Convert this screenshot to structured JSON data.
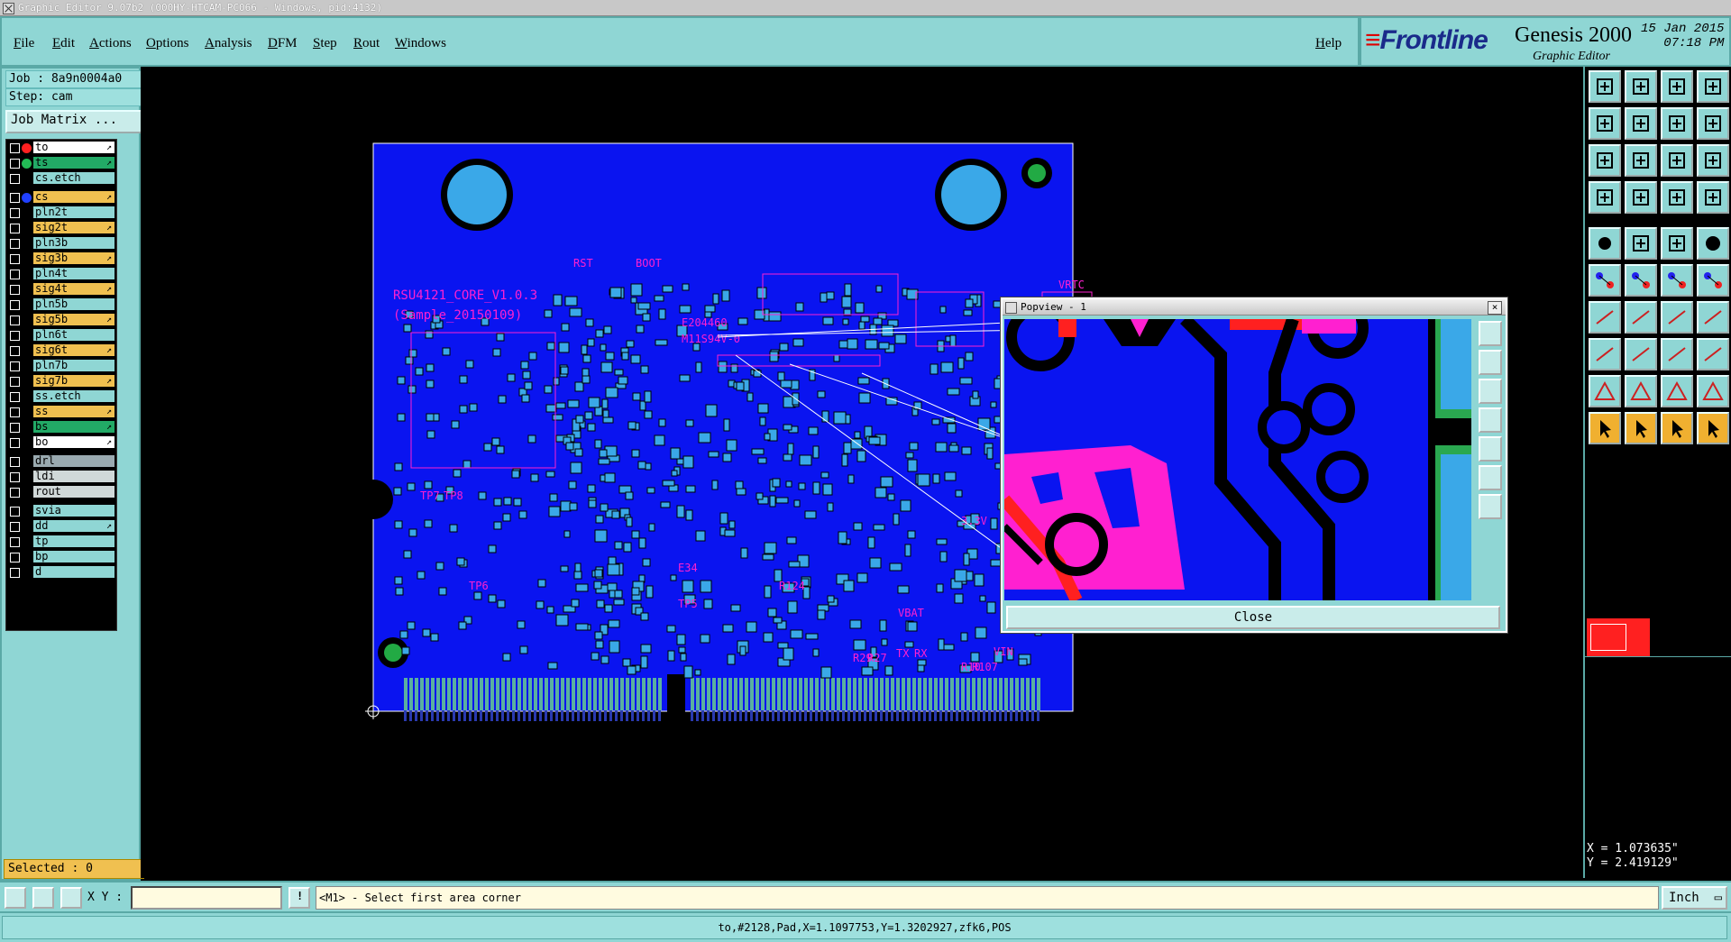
{
  "window": {
    "title": "Graphic Editor 9.07b2 (000HY-HTCAM-PC066 - Windows, pid:4132)"
  },
  "menu": [
    "File",
    "Edit",
    "Actions",
    "Options",
    "Analysis",
    "DFM",
    "Step",
    "Rout",
    "Windows"
  ],
  "help_label": "Help",
  "logo": {
    "brand": "Frontline",
    "product": "Genesis 2000",
    "subtitle": "Graphic Editor",
    "date": "15 Jan 2015",
    "time": "07:18 PM"
  },
  "job": {
    "job_label": "Job : 8a9n0004a0",
    "step_label": "Step: cam",
    "matrix_button": "Job Matrix ..."
  },
  "layers": [
    {
      "name": "to",
      "color": "#ffffff",
      "dot": "#ff2020",
      "arrow": "↗"
    },
    {
      "name": "ts",
      "color": "#22aa66",
      "dot": "#22bb55",
      "arrow": "↗"
    },
    {
      "name": "cs.etch",
      "color": "#8fd6d4",
      "dot": "",
      "arrow": ""
    },
    {
      "name": "cs",
      "color": "#f0c050",
      "dot": "#2040ff",
      "arrow": "↗"
    },
    {
      "name": "pln2t",
      "color": "#8fd6d4",
      "dot": "",
      "arrow": ""
    },
    {
      "name": "sig2t",
      "color": "#f0c050",
      "dot": "",
      "arrow": "↗"
    },
    {
      "name": "pln3b",
      "color": "#8fd6d4",
      "dot": "",
      "arrow": ""
    },
    {
      "name": "sig3b",
      "color": "#f0c050",
      "dot": "",
      "arrow": "↗"
    },
    {
      "name": "pln4t",
      "color": "#8fd6d4",
      "dot": "",
      "arrow": ""
    },
    {
      "name": "sig4t",
      "color": "#f0c050",
      "dot": "",
      "arrow": "↗"
    },
    {
      "name": "pln5b",
      "color": "#8fd6d4",
      "dot": "",
      "arrow": ""
    },
    {
      "name": "sig5b",
      "color": "#f0c050",
      "dot": "",
      "arrow": "↗"
    },
    {
      "name": "pln6t",
      "color": "#8fd6d4",
      "dot": "",
      "arrow": ""
    },
    {
      "name": "sig6t",
      "color": "#f0c050",
      "dot": "",
      "arrow": "↗"
    },
    {
      "name": "pln7b",
      "color": "#8fd6d4",
      "dot": "",
      "arrow": ""
    },
    {
      "name": "sig7b",
      "color": "#f0c050",
      "dot": "",
      "arrow": "↗"
    },
    {
      "name": "ss.etch",
      "color": "#8fd6d4",
      "dot": "",
      "arrow": ""
    },
    {
      "name": "ss",
      "color": "#f0c050",
      "dot": "",
      "arrow": "↗"
    },
    {
      "name": "bs",
      "color": "#22aa66",
      "dot": "",
      "arrow": "↗"
    },
    {
      "name": "bo",
      "color": "#ffffff",
      "dot": "",
      "arrow": "↗"
    },
    {
      "name": "drl",
      "color": "#9aaab0",
      "dot": "",
      "arrow": ""
    },
    {
      "name": "ldi",
      "color": "#d0d8d8",
      "dot": "",
      "arrow": ""
    },
    {
      "name": "rout",
      "color": "#d0d8d8",
      "dot": "",
      "arrow": ""
    },
    {
      "name": "svia",
      "color": "#8fd6d4",
      "dot": "",
      "arrow": ""
    },
    {
      "name": "dd",
      "color": "#8fd6d4",
      "dot": "",
      "arrow": "↗"
    },
    {
      "name": "tp",
      "color": "#8fd6d4",
      "dot": "",
      "arrow": ""
    },
    {
      "name": "bp",
      "color": "#8fd6d4",
      "dot": "",
      "arrow": ""
    },
    {
      "name": "d",
      "color": "#8fd6d4",
      "dot": "",
      "arrow": ""
    }
  ],
  "selected_label": "Selected : 0",
  "board": {
    "labels": [
      "RSU4121_CORE_V1.0.3",
      "(Sample_20150109)",
      "E204460",
      "M11S94V-0",
      "RST",
      "BOOT",
      "TP7",
      "TP8",
      "TP6",
      "TP5",
      "R124",
      "3.3V",
      "VBAT",
      "TX",
      "RX",
      "VIN",
      "R29",
      "R27",
      "R10",
      "R107",
      "E34",
      "VRTC"
    ]
  },
  "popview": {
    "title": "Popview - 1",
    "close_label": "Close"
  },
  "coords": {
    "x": "X = 1.073635\"",
    "y": "Y = 2.419129\""
  },
  "command": {
    "xy_label": "X Y :",
    "xy_value": "",
    "prompt": "<M1> - Select first area corner",
    "units": "Inch"
  },
  "status": "to,#2128,Pad,X=1.1097753,Y=1.3202927,zfk6,POS",
  "colors": {
    "panel": "#8fd6d4",
    "board": "#0a14f0",
    "pad": "#3aa8e8",
    "silk": "#ff20d0",
    "selected_tile": "#ff2020"
  }
}
